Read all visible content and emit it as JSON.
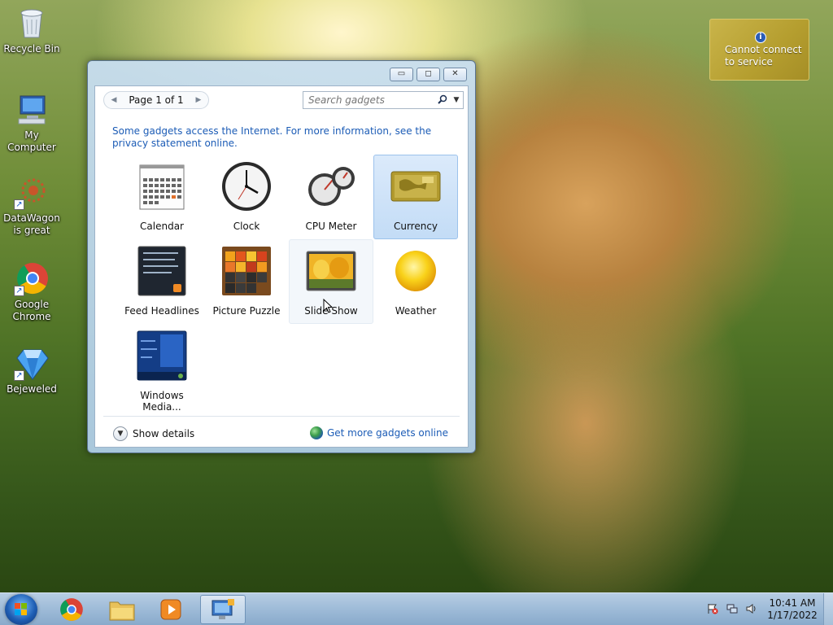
{
  "desktop": {
    "icons": [
      {
        "label": "Recycle Bin",
        "icon": "recycle-bin-icon"
      },
      {
        "label": "My Computer",
        "icon": "computer-icon"
      },
      {
        "label": "DataWagon is great",
        "icon": "datawagon-icon"
      },
      {
        "label": "Google Chrome",
        "icon": "chrome-icon"
      },
      {
        "label": "Bejeweled",
        "icon": "bejeweled-icon"
      }
    ]
  },
  "notification": {
    "line1": "Cannot connect",
    "line2": "to service"
  },
  "window": {
    "pager_label": "Page 1 of 1",
    "search_placeholder": "Search gadgets",
    "notice": "Some gadgets access the Internet.  For more information, see the privacy statement online.",
    "gadgets": [
      {
        "name": "Calendar",
        "state": "normal"
      },
      {
        "name": "Clock",
        "state": "normal"
      },
      {
        "name": "CPU Meter",
        "state": "normal"
      },
      {
        "name": "Currency",
        "state": "selected"
      },
      {
        "name": "Feed Headlines",
        "state": "normal"
      },
      {
        "name": "Picture Puzzle",
        "state": "normal"
      },
      {
        "name": "Slide Show",
        "state": "hover"
      },
      {
        "name": "Weather",
        "state": "normal"
      },
      {
        "name": "Windows Media...",
        "state": "normal"
      }
    ],
    "show_details": "Show details",
    "get_more": "Get more gadgets online"
  },
  "taskbar": {
    "items": [
      "start-orb",
      "chrome",
      "windows-explorer",
      "media-player",
      "gadgets"
    ],
    "clock": {
      "time": "10:41 AM",
      "date": "1/17/2022"
    }
  },
  "colors": {
    "link": "#1c5cb6",
    "selection": "#c3dcf6"
  }
}
